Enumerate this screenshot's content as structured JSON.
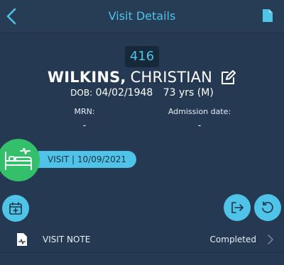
{
  "header": {
    "title": "Visit Details",
    "back_icon": "chevron-left-icon",
    "doc_icon": "document-icon"
  },
  "patient": {
    "room": "416",
    "last_name": "WILKINS,",
    "first_name": "CHRISTIAN",
    "dob_label": "DOB:",
    "dob": "04/02/1948",
    "age_sex": "73 yrs (M)",
    "mrn_label": "MRN:",
    "mrn_value": "-",
    "admission_label": "Admission date:",
    "admission_value": "-"
  },
  "visit": {
    "label": "VISIT | 10/09/2021",
    "icon": "hospital-bed-icon"
  },
  "actions": {
    "add_visit_icon": "calendar-add-icon",
    "exit_icon": "exit-icon",
    "restore_icon": "restore-icon"
  },
  "note": {
    "label": "VISIT NOTE",
    "status": "Completed",
    "icon": "medical-document-icon"
  },
  "colors": {
    "background": "#253a52",
    "accent": "#4fc3e8",
    "visit_green": "#34c06a"
  }
}
